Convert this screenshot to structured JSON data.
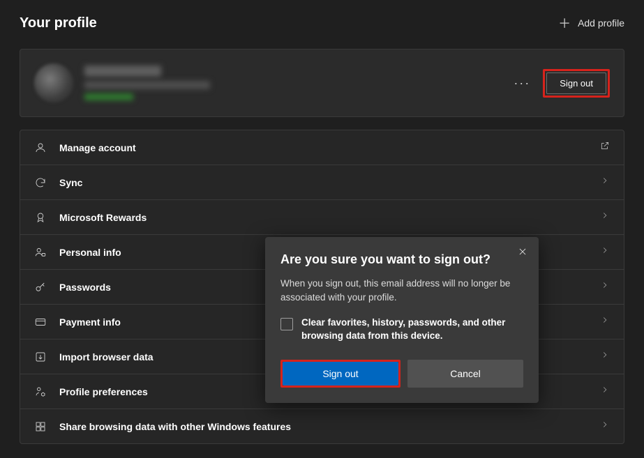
{
  "header": {
    "title": "Your profile",
    "add_profile_label": "Add profile"
  },
  "profile_card": {
    "more_label": "···",
    "signout_label": "Sign out"
  },
  "settings": [
    {
      "key": "manage-account",
      "label": "Manage account",
      "action": "external"
    },
    {
      "key": "sync",
      "label": "Sync",
      "action": "chevron"
    },
    {
      "key": "microsoft-rewards",
      "label": "Microsoft Rewards",
      "action": "chevron"
    },
    {
      "key": "personal-info",
      "label": "Personal info",
      "action": "chevron"
    },
    {
      "key": "passwords",
      "label": "Passwords",
      "action": "chevron"
    },
    {
      "key": "payment-info",
      "label": "Payment info",
      "action": "chevron"
    },
    {
      "key": "import-browser-data",
      "label": "Import browser data",
      "action": "chevron"
    },
    {
      "key": "profile-preferences",
      "label": "Profile preferences",
      "action": "chevron"
    },
    {
      "key": "share-browsing-data",
      "label": "Share browsing data with other Windows features",
      "action": "chevron"
    }
  ],
  "dialog": {
    "title": "Are you sure you want to sign out?",
    "body": "When you sign out, this email address will no longer be associated with your profile.",
    "checkbox_label": "Clear favorites, history, passwords, and other browsing data from this device.",
    "signout_label": "Sign out",
    "cancel_label": "Cancel"
  }
}
